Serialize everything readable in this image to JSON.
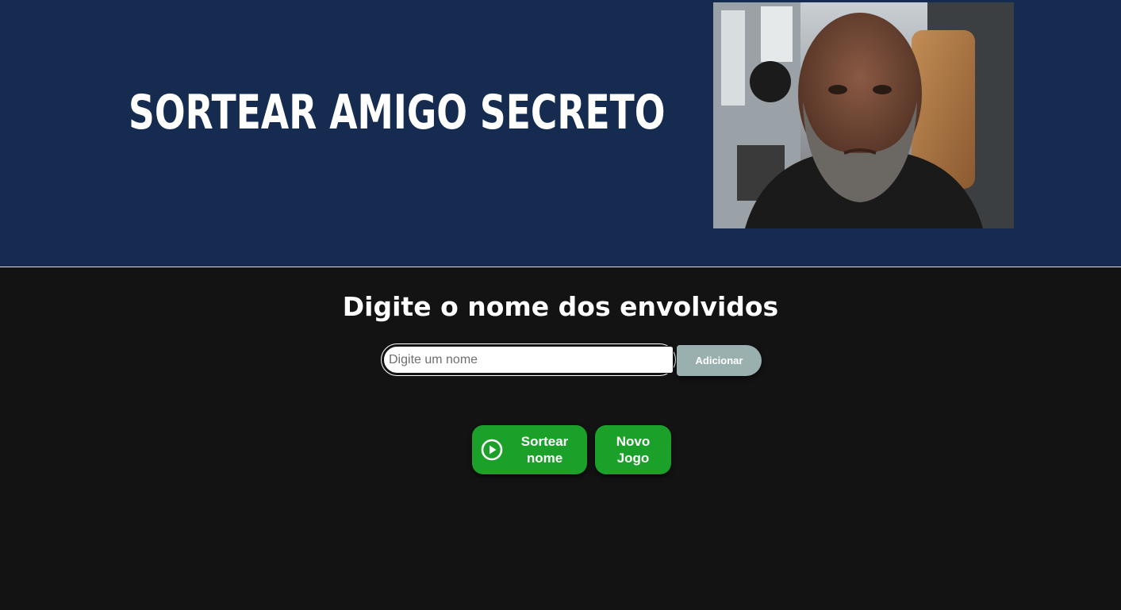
{
  "header": {
    "title": "SORTEAR AMIGO SECRETO",
    "photo_alt": "Foto"
  },
  "main": {
    "subtitle": "Digite o nome dos envolvidos",
    "name_input": {
      "placeholder": "Digite um nome",
      "value": ""
    },
    "add_button_label": "Adicionar",
    "draw_button": {
      "line1": "Sortear",
      "line2": "nome",
      "icon": "play-circle-icon"
    },
    "new_game_button": {
      "line1": "Novo",
      "line2": "Jogo"
    }
  },
  "colors": {
    "header_bg": "#152b4f",
    "body_bg": "#131313",
    "green": "#1ba12a",
    "add_button_bg": "#9ab0ae"
  }
}
